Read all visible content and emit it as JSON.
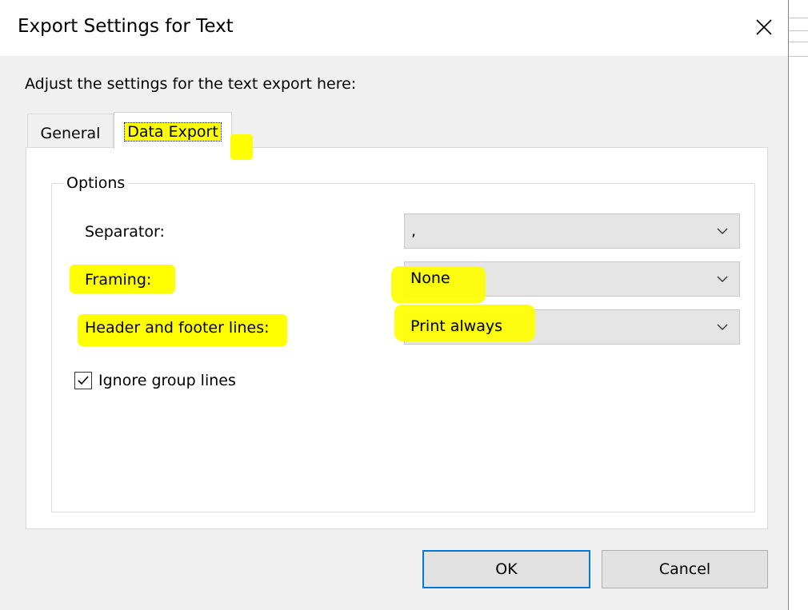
{
  "dialog": {
    "title": "Export Settings for Text",
    "instruction": "Adjust the settings for the text export here:"
  },
  "tabs": [
    {
      "label": "General",
      "selected": false
    },
    {
      "label": "Data Export",
      "selected": true
    }
  ],
  "group": {
    "legend": "Options",
    "fields": [
      {
        "label": "Separator:",
        "value": ",",
        "highlighted": false
      },
      {
        "label": "Framing:",
        "value": "None",
        "highlighted": true
      },
      {
        "label": "Header and footer lines:",
        "value": "Print always",
        "highlighted": true
      }
    ],
    "checkbox": {
      "label": "Ignore group lines",
      "checked": true
    }
  },
  "buttons": {
    "ok": "OK",
    "cancel": "Cancel"
  },
  "icons": {
    "close": "close-icon",
    "dropdown": "chevron-down-icon",
    "check": "checkmark-icon"
  },
  "colors": {
    "highlight": "#ffff00",
    "focus_border": "#0078d7",
    "dialog_bg": "#f0f0f0",
    "combo_bg": "#e5e5e5"
  }
}
